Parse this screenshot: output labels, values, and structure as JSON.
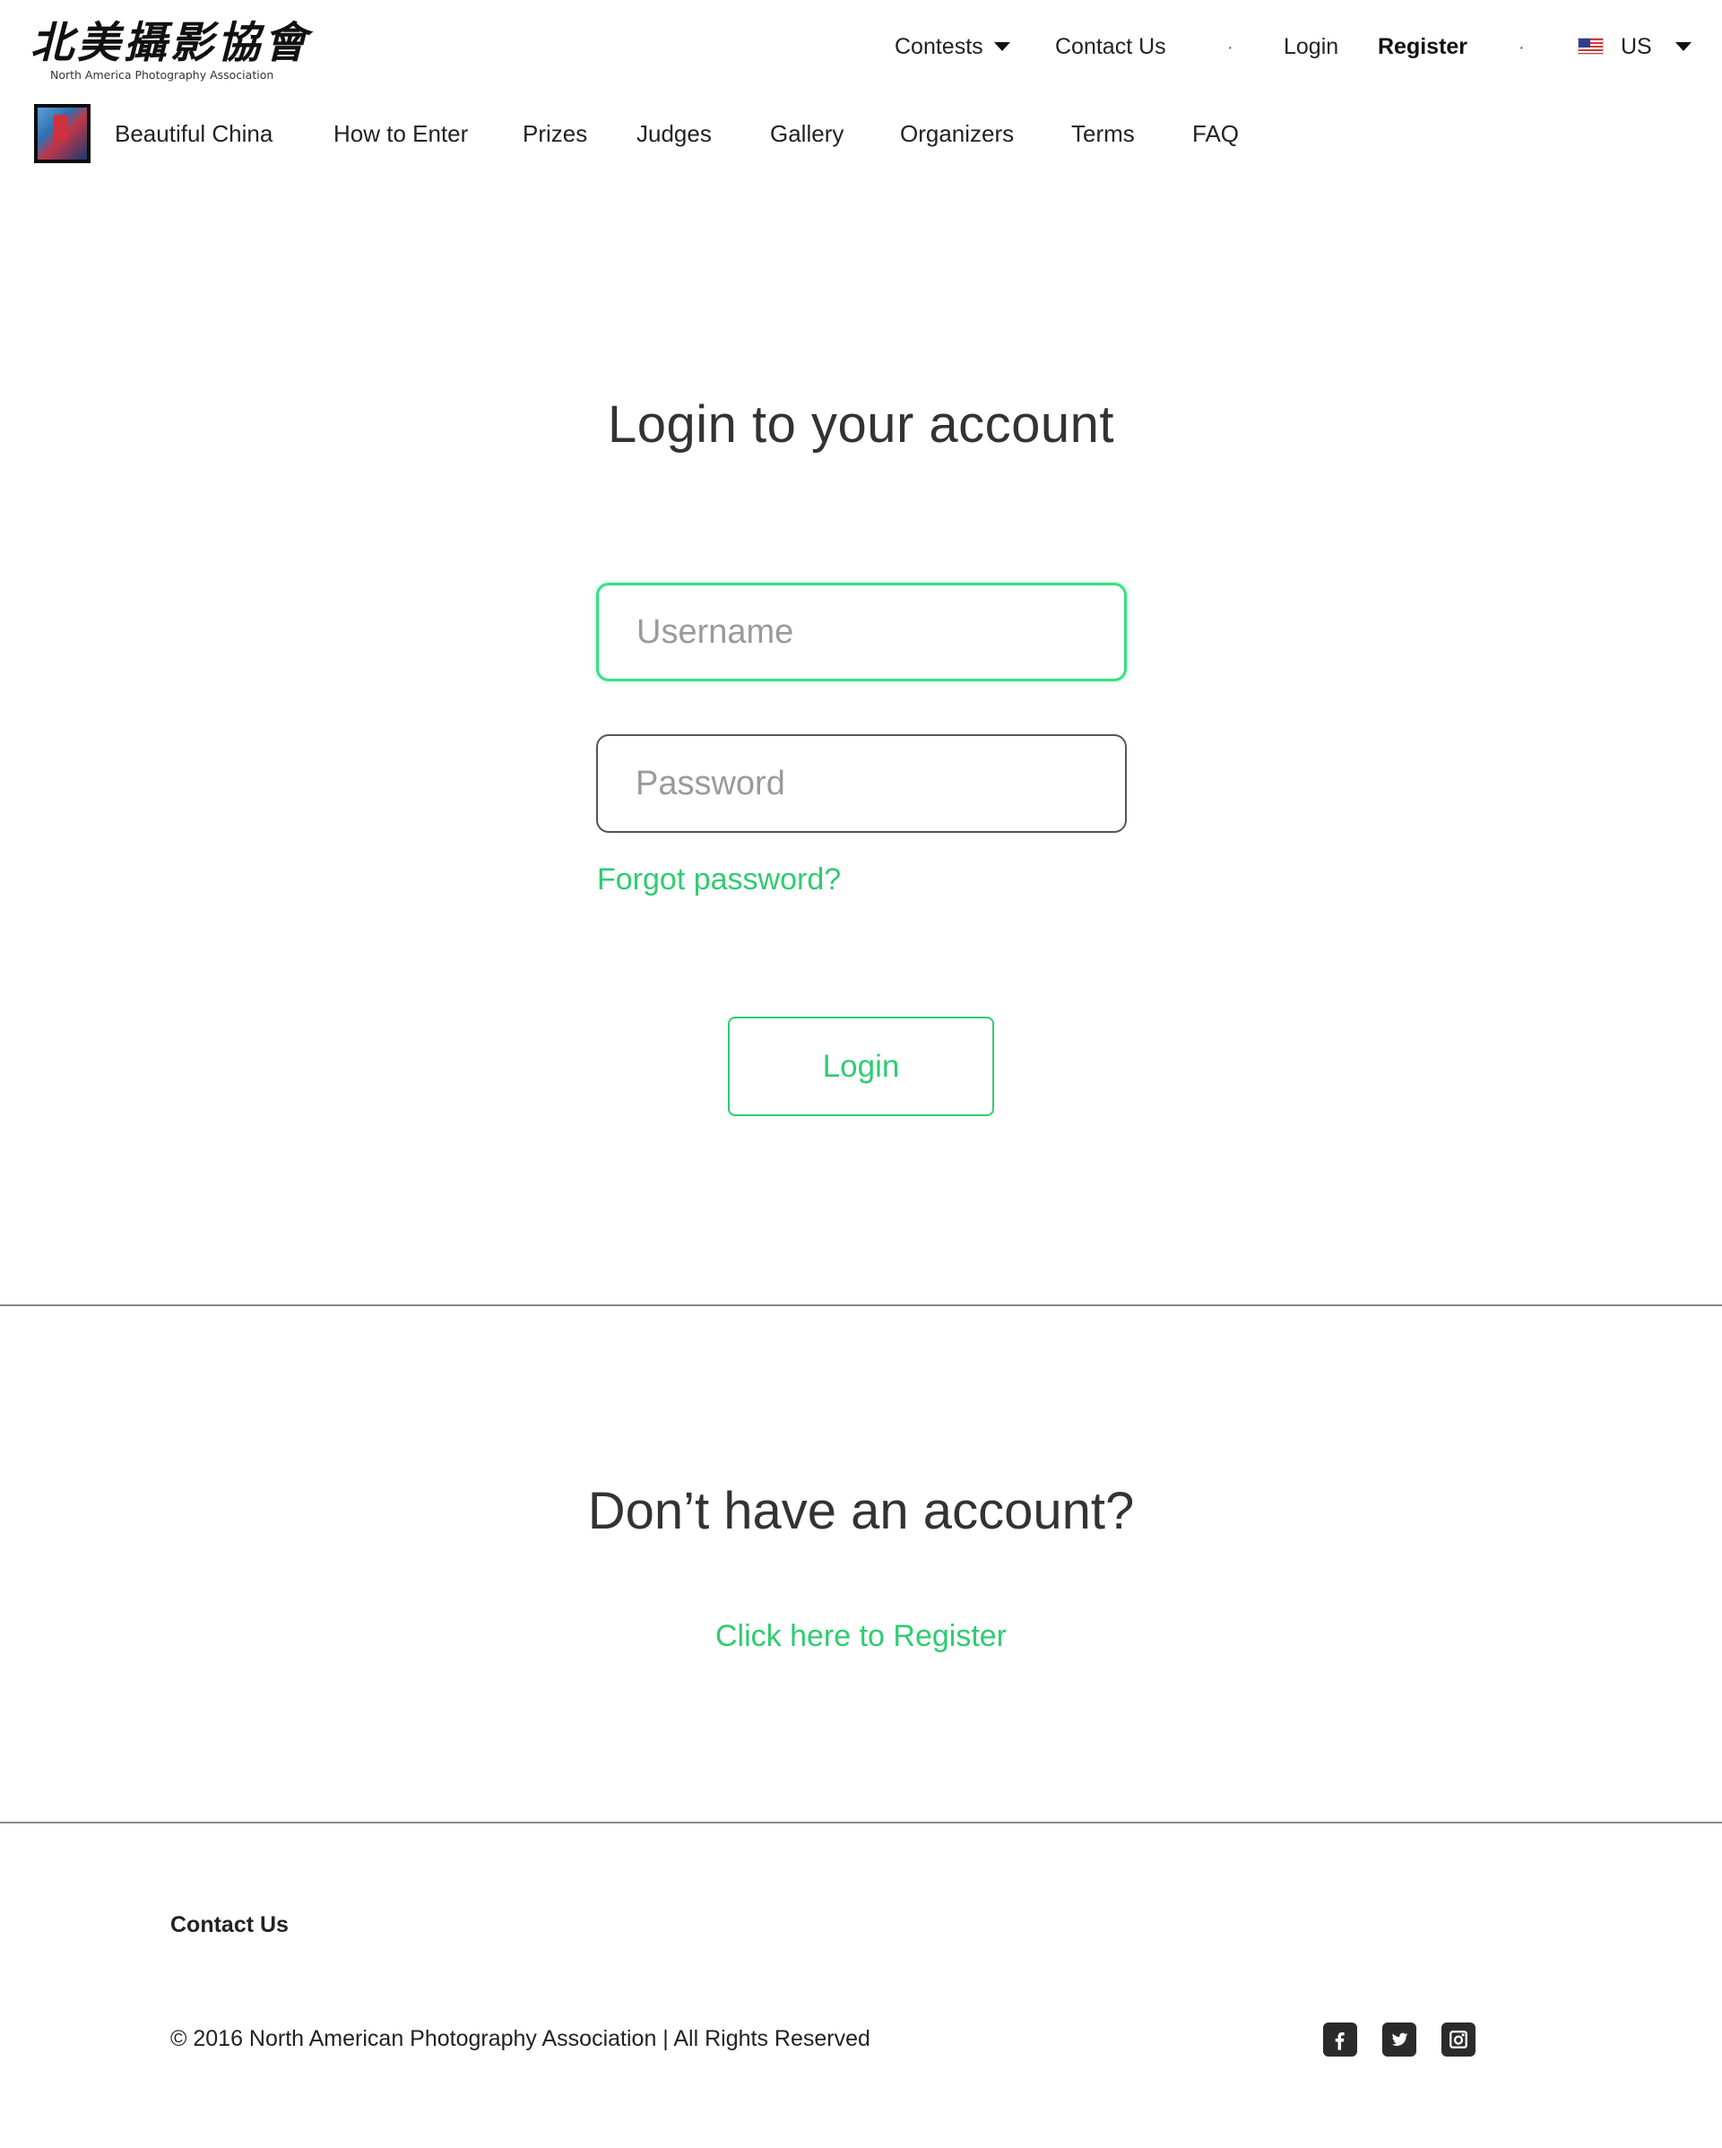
{
  "header": {
    "logo_cn": "北美攝影協會",
    "logo_en": "North America Photography Association",
    "nav": {
      "contests": "Contests",
      "contact": "Contact Us",
      "separator": "·",
      "login": "Login",
      "register": "Register",
      "language": "US"
    }
  },
  "contest_nav": {
    "items": [
      "Beautiful China",
      "How to Enter",
      "Prizes",
      "Judges",
      "Gallery",
      "Organizers",
      "Terms",
      "FAQ"
    ]
  },
  "login": {
    "title": "Login to your account",
    "username_placeholder": "Username",
    "password_placeholder": "Password",
    "forgot": "Forgot password?",
    "button": "Login"
  },
  "register": {
    "title": "Don’t have an account?",
    "link": "Click here to Register"
  },
  "footer": {
    "contact": "Contact Us",
    "copyright": "©  2016 North American Photography Association | All Rights Reserved",
    "social_icons": [
      "facebook-icon",
      "twitter-icon",
      "instagram-icon"
    ]
  },
  "colors": {
    "accent": "#2ecc71",
    "focus_border": "#37e087",
    "text": "#333333",
    "divider": "#888888"
  }
}
